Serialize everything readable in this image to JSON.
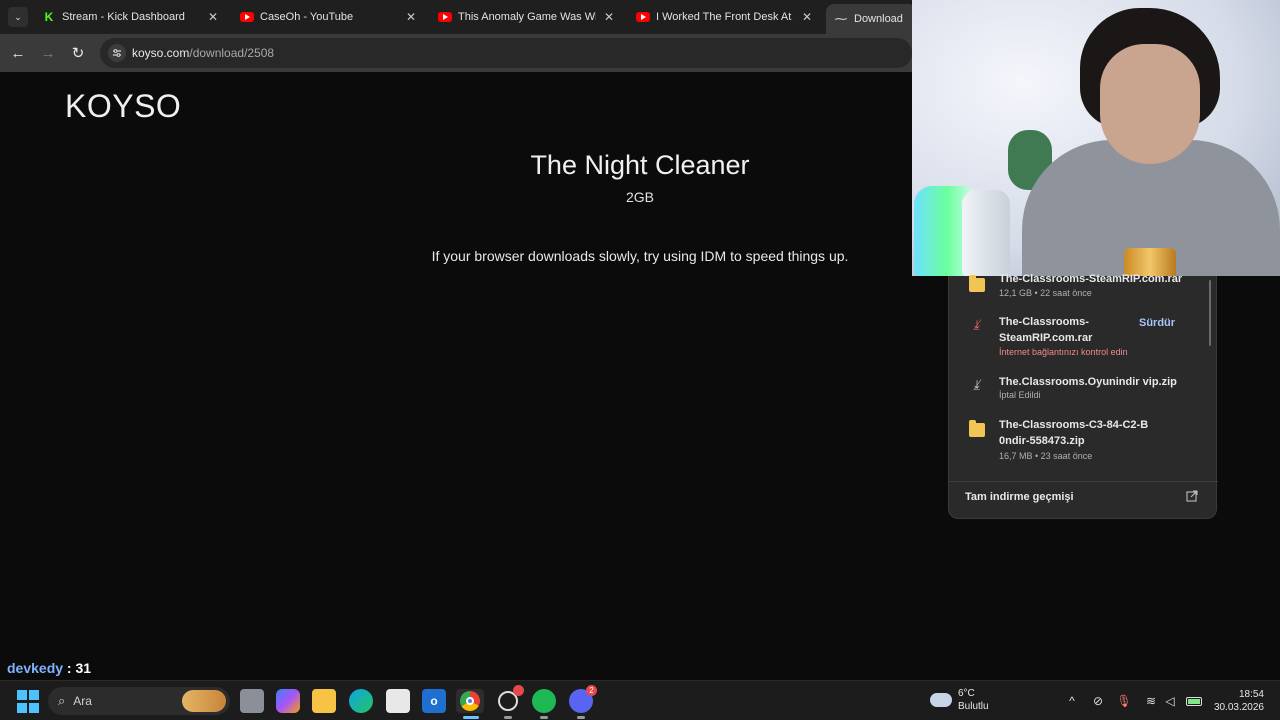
{
  "browser": {
    "tabs": [
      {
        "title": "Stream - Kick Dashboard",
        "favicon": "kick-icon"
      },
      {
        "title": "CaseOh - YouTube",
        "favicon": "youtube-icon"
      },
      {
        "title": "This Anomaly Game Was Wild...",
        "favicon": "youtube-icon"
      },
      {
        "title": "I Worked The Front Desk At A M...",
        "favicon": "youtube-icon"
      },
      {
        "title": "Download",
        "favicon": "loading-icon"
      }
    ],
    "url_host": "koyso.com",
    "url_path": "/download/2508"
  },
  "page": {
    "logo": "KOYSO",
    "game_title": "The Night Cleaner",
    "game_size": "2GB",
    "hint": "If your browser downloads slowly, try using IDM to speed things up."
  },
  "downloads": {
    "items": [
      {
        "name": "The-Classrooms-SteamRIP.com.rar",
        "meta": "12,1 GB • 22 saat önce",
        "icon": "folder-icon",
        "status": "done"
      },
      {
        "name": "The-Classrooms-SteamRIP.com.rar",
        "meta": "İnternet bağlantınızı kontrol edin",
        "icon": "download-failed-icon",
        "status": "error",
        "action": "Sürdür"
      },
      {
        "name": "The.Classrooms.Oyunindir vip.zip",
        "meta": "İptal Edildi",
        "icon": "download-cancelled-icon",
        "status": "cancelled"
      },
      {
        "name": "The-Classrooms-C3-84-C2-B0ndir-558473.zip",
        "meta": "16,7 MB • 23 saat önce",
        "icon": "folder-icon",
        "status": "done"
      }
    ],
    "footer": "Tam indirme geçmişi"
  },
  "chat": {
    "user": "devkedy",
    "message": "31"
  },
  "taskbar": {
    "search_placeholder": "Ara",
    "weather_temp": "6°C",
    "weather_desc": "Bulutlu",
    "time": "18:54",
    "date": "30.03.2026",
    "discord_badge": "2"
  },
  "colors": {
    "accent_link": "#a8c7fa",
    "error": "#f08a8a",
    "chat_user": "#7fb3ff"
  }
}
